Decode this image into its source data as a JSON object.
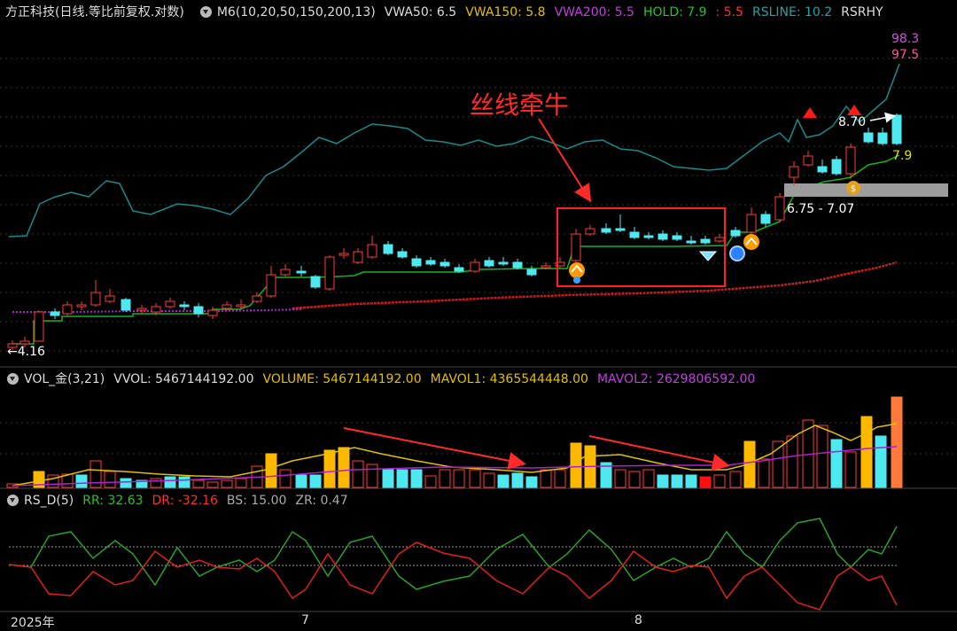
{
  "main_legend": {
    "title": "方正科技(日线.等比前复权.对数)",
    "m6": "M6(10,20,50,150,200,13)",
    "vwa50": "VWA50: 6.5",
    "vwa150": "VWA150: 5.8",
    "vwa200": "VWA200: 5.5",
    "hold": "HOLD: 7.9",
    "hold2": ": 5.5",
    "rsline": "RSLINE: 10.2",
    "rsrh": "RSRHY"
  },
  "vol_legend": {
    "title": "VOL_金(3,21)",
    "vvol": "VVOL: 5467144192.00",
    "volume": "VOLUME: 5467144192.00",
    "mavol1": "MAVOL1: 4365544448.00",
    "mavol2": "MAVOL2: 2629806592.00"
  },
  "rs_legend": {
    "title": "RS_D(5)",
    "rr": "RR: 32.63",
    "dr": "DR: -32.16",
    "bs": "BS: 15.00",
    "zr": "ZR: 0.47"
  },
  "annotations": {
    "callout": "丝线牵牛",
    "low_label": "←4.16",
    "high_label": "8.70",
    "hold_value": "7.9",
    "zone_label": "6.75 - 7.07",
    "rsline_top": "98.3",
    "rs_second": "97.5"
  },
  "x_axis": {
    "year": "2025年",
    "m7": "7",
    "m8": "8"
  },
  "colors": {
    "up": "#ff3b3b",
    "down": "#4ee8f0",
    "vol_gold": "#ffb800",
    "hold": "#19b219",
    "rsline": "#1a8a8a",
    "vwa200": "#c02020",
    "vwa150": "#b020d0",
    "mavol1": "#e0c000",
    "mavol2": "#b020d0",
    "rr": "#2ca02c",
    "dr": "#e02020"
  }
}
